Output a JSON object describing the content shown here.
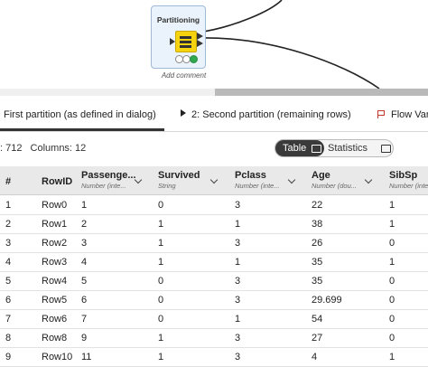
{
  "node": {
    "title": "Partitioning",
    "comment": "Add comment"
  },
  "tabs": [
    {
      "label": "First partition (as defined in dialog)",
      "active": true
    },
    {
      "label": "2: Second partition (remaining rows)",
      "active": false
    },
    {
      "label": "Flow Vari",
      "active": false
    }
  ],
  "counts": {
    "rows_text": ": 712",
    "columns_text": "Columns: 12"
  },
  "view_toggle": {
    "table_label": "Table",
    "statistics_label": "Statistics",
    "selected": "Table"
  },
  "colors": {
    "node_yellow": "#f5d40f",
    "toggle_active": "#3a3a3a",
    "header_bg": "#e9e9e9"
  },
  "table": {
    "columns": [
      {
        "name": "#",
        "type": ""
      },
      {
        "name": "RowID",
        "type": ""
      },
      {
        "name": "Passenge...",
        "type": "Number (inte..."
      },
      {
        "name": "Survived",
        "type": "String"
      },
      {
        "name": "Pclass",
        "type": "Number (inte..."
      },
      {
        "name": "Age",
        "type": "Number (dou..."
      },
      {
        "name": "SibSp",
        "type": "Number (inte"
      }
    ],
    "rows": [
      [
        "1",
        "Row0",
        "1",
        "0",
        "3",
        "22",
        "1"
      ],
      [
        "2",
        "Row1",
        "2",
        "1",
        "1",
        "38",
        "1"
      ],
      [
        "3",
        "Row2",
        "3",
        "1",
        "3",
        "26",
        "0"
      ],
      [
        "4",
        "Row3",
        "4",
        "1",
        "1",
        "35",
        "1"
      ],
      [
        "5",
        "Row4",
        "5",
        "0",
        "3",
        "35",
        "0"
      ],
      [
        "6",
        "Row5",
        "6",
        "0",
        "3",
        "29.699",
        "0"
      ],
      [
        "7",
        "Row6",
        "7",
        "0",
        "1",
        "54",
        "0"
      ],
      [
        "8",
        "Row8",
        "9",
        "1",
        "3",
        "27",
        "0"
      ],
      [
        "9",
        "Row10",
        "11",
        "1",
        "3",
        "4",
        "1"
      ]
    ]
  }
}
